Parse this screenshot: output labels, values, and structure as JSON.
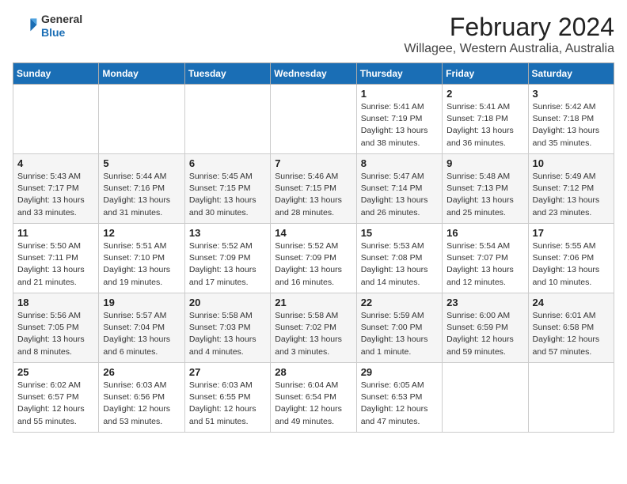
{
  "header": {
    "logo_general": "General",
    "logo_blue": "Blue",
    "title": "February 2024",
    "subtitle": "Willagee, Western Australia, Australia"
  },
  "days_of_week": [
    "Sunday",
    "Monday",
    "Tuesday",
    "Wednesday",
    "Thursday",
    "Friday",
    "Saturday"
  ],
  "weeks": [
    [
      {
        "day": "",
        "detail": ""
      },
      {
        "day": "",
        "detail": ""
      },
      {
        "day": "",
        "detail": ""
      },
      {
        "day": "",
        "detail": ""
      },
      {
        "day": "1",
        "detail": "Sunrise: 5:41 AM\nSunset: 7:19 PM\nDaylight: 13 hours\nand 38 minutes."
      },
      {
        "day": "2",
        "detail": "Sunrise: 5:41 AM\nSunset: 7:18 PM\nDaylight: 13 hours\nand 36 minutes."
      },
      {
        "day": "3",
        "detail": "Sunrise: 5:42 AM\nSunset: 7:18 PM\nDaylight: 13 hours\nand 35 minutes."
      }
    ],
    [
      {
        "day": "4",
        "detail": "Sunrise: 5:43 AM\nSunset: 7:17 PM\nDaylight: 13 hours\nand 33 minutes."
      },
      {
        "day": "5",
        "detail": "Sunrise: 5:44 AM\nSunset: 7:16 PM\nDaylight: 13 hours\nand 31 minutes."
      },
      {
        "day": "6",
        "detail": "Sunrise: 5:45 AM\nSunset: 7:15 PM\nDaylight: 13 hours\nand 30 minutes."
      },
      {
        "day": "7",
        "detail": "Sunrise: 5:46 AM\nSunset: 7:15 PM\nDaylight: 13 hours\nand 28 minutes."
      },
      {
        "day": "8",
        "detail": "Sunrise: 5:47 AM\nSunset: 7:14 PM\nDaylight: 13 hours\nand 26 minutes."
      },
      {
        "day": "9",
        "detail": "Sunrise: 5:48 AM\nSunset: 7:13 PM\nDaylight: 13 hours\nand 25 minutes."
      },
      {
        "day": "10",
        "detail": "Sunrise: 5:49 AM\nSunset: 7:12 PM\nDaylight: 13 hours\nand 23 minutes."
      }
    ],
    [
      {
        "day": "11",
        "detail": "Sunrise: 5:50 AM\nSunset: 7:11 PM\nDaylight: 13 hours\nand 21 minutes."
      },
      {
        "day": "12",
        "detail": "Sunrise: 5:51 AM\nSunset: 7:10 PM\nDaylight: 13 hours\nand 19 minutes."
      },
      {
        "day": "13",
        "detail": "Sunrise: 5:52 AM\nSunset: 7:09 PM\nDaylight: 13 hours\nand 17 minutes."
      },
      {
        "day": "14",
        "detail": "Sunrise: 5:52 AM\nSunset: 7:09 PM\nDaylight: 13 hours\nand 16 minutes."
      },
      {
        "day": "15",
        "detail": "Sunrise: 5:53 AM\nSunset: 7:08 PM\nDaylight: 13 hours\nand 14 minutes."
      },
      {
        "day": "16",
        "detail": "Sunrise: 5:54 AM\nSunset: 7:07 PM\nDaylight: 13 hours\nand 12 minutes."
      },
      {
        "day": "17",
        "detail": "Sunrise: 5:55 AM\nSunset: 7:06 PM\nDaylight: 13 hours\nand 10 minutes."
      }
    ],
    [
      {
        "day": "18",
        "detail": "Sunrise: 5:56 AM\nSunset: 7:05 PM\nDaylight: 13 hours\nand 8 minutes."
      },
      {
        "day": "19",
        "detail": "Sunrise: 5:57 AM\nSunset: 7:04 PM\nDaylight: 13 hours\nand 6 minutes."
      },
      {
        "day": "20",
        "detail": "Sunrise: 5:58 AM\nSunset: 7:03 PM\nDaylight: 13 hours\nand 4 minutes."
      },
      {
        "day": "21",
        "detail": "Sunrise: 5:58 AM\nSunset: 7:02 PM\nDaylight: 13 hours\nand 3 minutes."
      },
      {
        "day": "22",
        "detail": "Sunrise: 5:59 AM\nSunset: 7:00 PM\nDaylight: 13 hours\nand 1 minute."
      },
      {
        "day": "23",
        "detail": "Sunrise: 6:00 AM\nSunset: 6:59 PM\nDaylight: 12 hours\nand 59 minutes."
      },
      {
        "day": "24",
        "detail": "Sunrise: 6:01 AM\nSunset: 6:58 PM\nDaylight: 12 hours\nand 57 minutes."
      }
    ],
    [
      {
        "day": "25",
        "detail": "Sunrise: 6:02 AM\nSunset: 6:57 PM\nDaylight: 12 hours\nand 55 minutes."
      },
      {
        "day": "26",
        "detail": "Sunrise: 6:03 AM\nSunset: 6:56 PM\nDaylight: 12 hours\nand 53 minutes."
      },
      {
        "day": "27",
        "detail": "Sunrise: 6:03 AM\nSunset: 6:55 PM\nDaylight: 12 hours\nand 51 minutes."
      },
      {
        "day": "28",
        "detail": "Sunrise: 6:04 AM\nSunset: 6:54 PM\nDaylight: 12 hours\nand 49 minutes."
      },
      {
        "day": "29",
        "detail": "Sunrise: 6:05 AM\nSunset: 6:53 PM\nDaylight: 12 hours\nand 47 minutes."
      },
      {
        "day": "",
        "detail": ""
      },
      {
        "day": "",
        "detail": ""
      }
    ]
  ]
}
